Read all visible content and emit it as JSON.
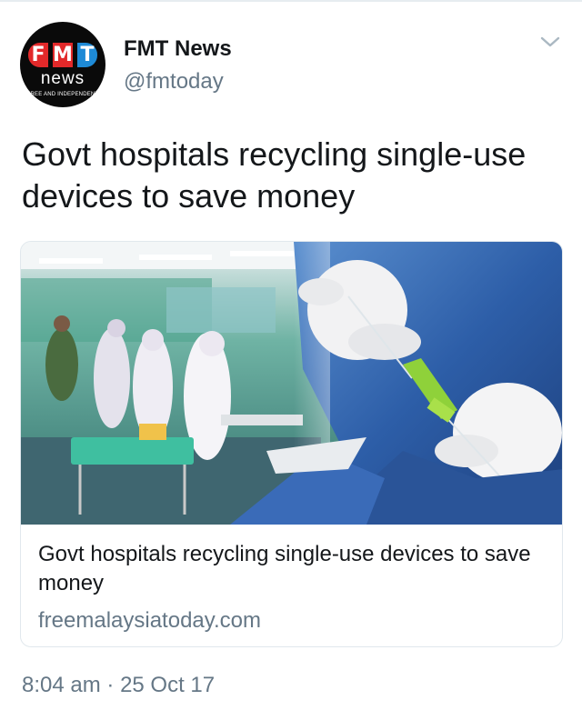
{
  "tweet": {
    "author": {
      "name": "FMT News",
      "handle": "@fmtoday",
      "avatar": {
        "letters": [
          "F",
          "M",
          "T"
        ],
        "word": "news",
        "tagline": "FREE AND INDEPENDENT"
      }
    },
    "menu_icon": "chevron-down-icon",
    "text": "Govt hospitals recycling single-use devices to save money",
    "card": {
      "title": "Govt hospitals recycling single-use devices to save money",
      "domain": "freemalaysiatoday.com",
      "image_subject": "hospital-ward-and-gloved-hands-with-catheter"
    },
    "time": "8:04 am",
    "separator": "·",
    "date": "25 Oct 17"
  },
  "colors": {
    "text_primary": "#14171a",
    "text_secondary": "#657786",
    "border": "#e1e8ed",
    "logo_red": "#e2292a",
    "logo_blue": "#1e8ad6"
  }
}
